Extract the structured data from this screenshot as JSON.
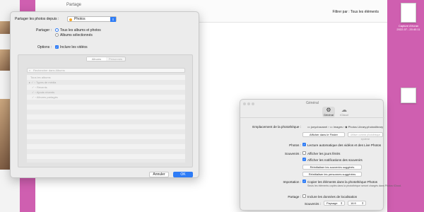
{
  "finder": {
    "title": "Partage",
    "filter_label": "Filtrer par : Tous les éléments"
  },
  "desktop": {
    "file_label": "Capture d'écran",
    "file_date": "2022-07...20.40.11"
  },
  "sheet": {
    "share_label": "Partager les photos depuis :",
    "share_source": "Photos",
    "share_scope_label": "Partager :",
    "radio_all": "Tous les albums et photos",
    "radio_selected": "Albums sélectionnés",
    "options_label": "Options :",
    "include_videos": "Inclure les vidéos",
    "segments": [
      "Albums",
      "Personnes"
    ],
    "search_placeholder": "Rechercher dans Albums",
    "list_items": [
      "Tous les albums",
      "Types de média",
      "Récents",
      "Ajouts récents",
      "Albums partagés"
    ],
    "cancel_label": "Annuler",
    "ok_label": "OK"
  },
  "prefs": {
    "title": "Général",
    "tabs": [
      "Général",
      "iCloud"
    ],
    "library_label": "Emplacement de la photothèque :",
    "path": [
      "jonychavanel",
      "Images",
      "Photos Library.photoslibrary"
    ],
    "show_in_finder": "Afficher dans le Finder",
    "use_system_library": "Utiliser comme photothèque système",
    "photos_label": "Photos :",
    "autoplay": "Lecture automatique des vidéos et des Live Photos",
    "memories_label": "Souvenirs :",
    "show_holidays": "Afficher les jours fériés",
    "show_notifications": "Afficher les notifications des souvenirs",
    "reset_memories": "Réinitialiser les souvenirs suggérés",
    "reset_people": "Réinitialiser les personnes suggérées",
    "import_label": "Importation :",
    "copy_items": "Copier les éléments dans la photothèque Photos",
    "copy_note": "Seuls les éléments copiés dans la photothèque seront chargés dans Photos iCloud.",
    "sharing_label": "Partage :",
    "include_location": "Inclure les données de localisation",
    "memories_value_label": "Souvenirs :",
    "country": "Paysage",
    "year": "16:9"
  }
}
